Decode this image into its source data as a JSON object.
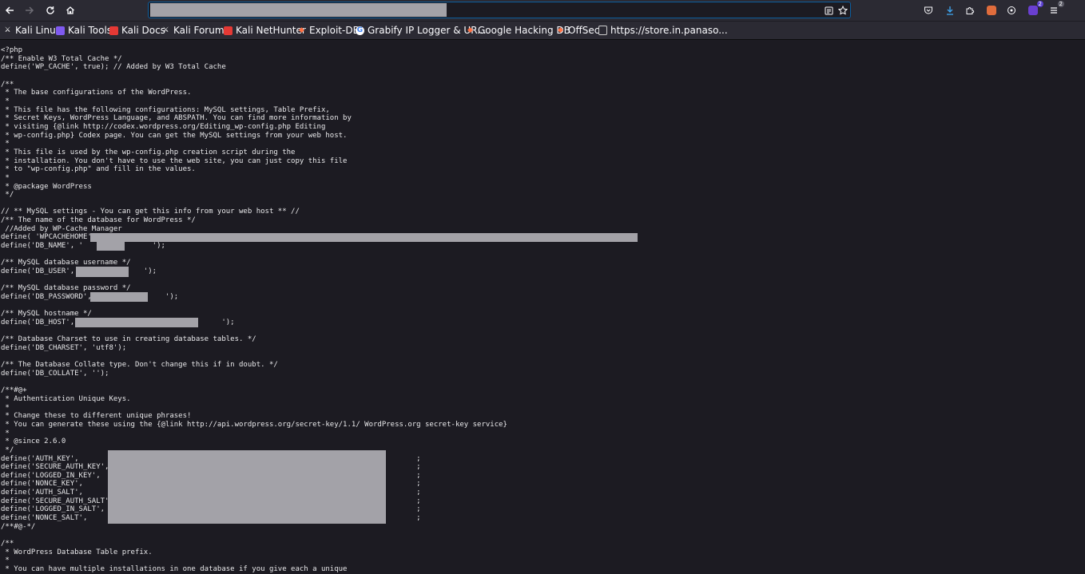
{
  "toolbar": {
    "back_icon": "arrow-left",
    "forward_icon": "arrow-right",
    "reload_icon": "reload",
    "home_icon": "home",
    "url_redacted": true,
    "badge_counts": [
      "2",
      "2"
    ]
  },
  "bookmarks": [
    {
      "label": "Kali Linux",
      "icon": "kali-dragon-icon",
      "color": "#ffffff"
    },
    {
      "label": "Kali Tools",
      "icon": "kali-tools-icon",
      "color": "#7f5af0"
    },
    {
      "label": "Kali Docs",
      "icon": "kali-docs-icon",
      "color": "#e53935"
    },
    {
      "label": "Kali Forums",
      "icon": "kali-dragon-icon",
      "color": "#ffffff"
    },
    {
      "label": "Kali NetHunter",
      "icon": "nethunter-icon",
      "color": "#e53935"
    },
    {
      "label": "Exploit-DB",
      "icon": "exploit-db-icon",
      "color": "#ff7043"
    },
    {
      "label": "Grabify IP Logger & UR...",
      "icon": "google-icon",
      "color": "#4285f4"
    },
    {
      "label": "Google Hacking DB",
      "icon": "exploit-db-icon",
      "color": "#ff7043"
    },
    {
      "label": "OffSec",
      "icon": "offsec-icon",
      "color": "#ff7043"
    },
    {
      "label": "https://store.in.panaso...",
      "icon": "page-icon",
      "color": "#cccccc"
    }
  ],
  "source_lines": [
    "<?php",
    "/** Enable W3 Total Cache */",
    "define('WP_CACHE', true); // Added by W3 Total Cache",
    "",
    "/**",
    " * The base configurations of the WordPress.",
    " *",
    " * This file has the following configurations: MySQL settings, Table Prefix,",
    " * Secret Keys, WordPress Language, and ABSPATH. You can find more information by",
    " * visiting {@link http://codex.wordpress.org/Editing_wp-config.php Editing",
    " * wp-config.php} Codex page. You can get the MySQL settings from your web host.",
    " *",
    " * This file is used by the wp-config.php creation script during the",
    " * installation. You don't have to use the web site, you can just copy this file",
    " * to \"wp-config.php\" and fill in the values.",
    " *",
    " * @package WordPress",
    " */",
    "",
    "// ** MySQL settings - You can get this info from your web host ** //",
    "/** The name of the database for WordPress */",
    " //Added by WP-Cache Manager",
    "define( 'WPCACHEHOME',",
    "define('DB_NAME', '                ');",
    "",
    "/** MySQL database username */",
    "define('DB_USER', '              ');",
    "",
    "/** MySQL database password */",
    "define('DB_PASSWORD', '               ');",
    "",
    "/** MySQL hostname */",
    "define('DB_HOST', '                                ');",
    "",
    "/** Database Charset to use in creating database tables. */",
    "define('DB_CHARSET', 'utf8');",
    "",
    "/** The Database Collate type. Don't change this if in doubt. */",
    "define('DB_COLLATE', '');",
    "",
    "/**#@+",
    " * Authentication Unique Keys.",
    " *",
    " * Change these to different unique phrases!",
    " * You can generate these using the {@link http://api.wordpress.org/secret-key/1.1/ WordPress.org secret-key service}",
    " *",
    " * @since 2.6.0",
    " */",
    "define('AUTH_KEY',                                                                              ;",
    "define('SECURE_AUTH_KEY',                                                                       ;",
    "define('LOGGED_IN_KEY',                                                                         ;",
    "define('NONCE_KEY',                                                                             ;",
    "define('AUTH_SALT',                                                                             ;",
    "define('SECURE_AUTH_SALT',                                                                      ;",
    "define('LOGGED_IN_SALT',                                                                        ;",
    "define('NONCE_SALT',                                                                            ;",
    "/**#@-*/",
    "",
    "/**",
    " * WordPress Database Table prefix.",
    " *",
    " * You can have multiple installations in one database if you give each a unique"
  ]
}
